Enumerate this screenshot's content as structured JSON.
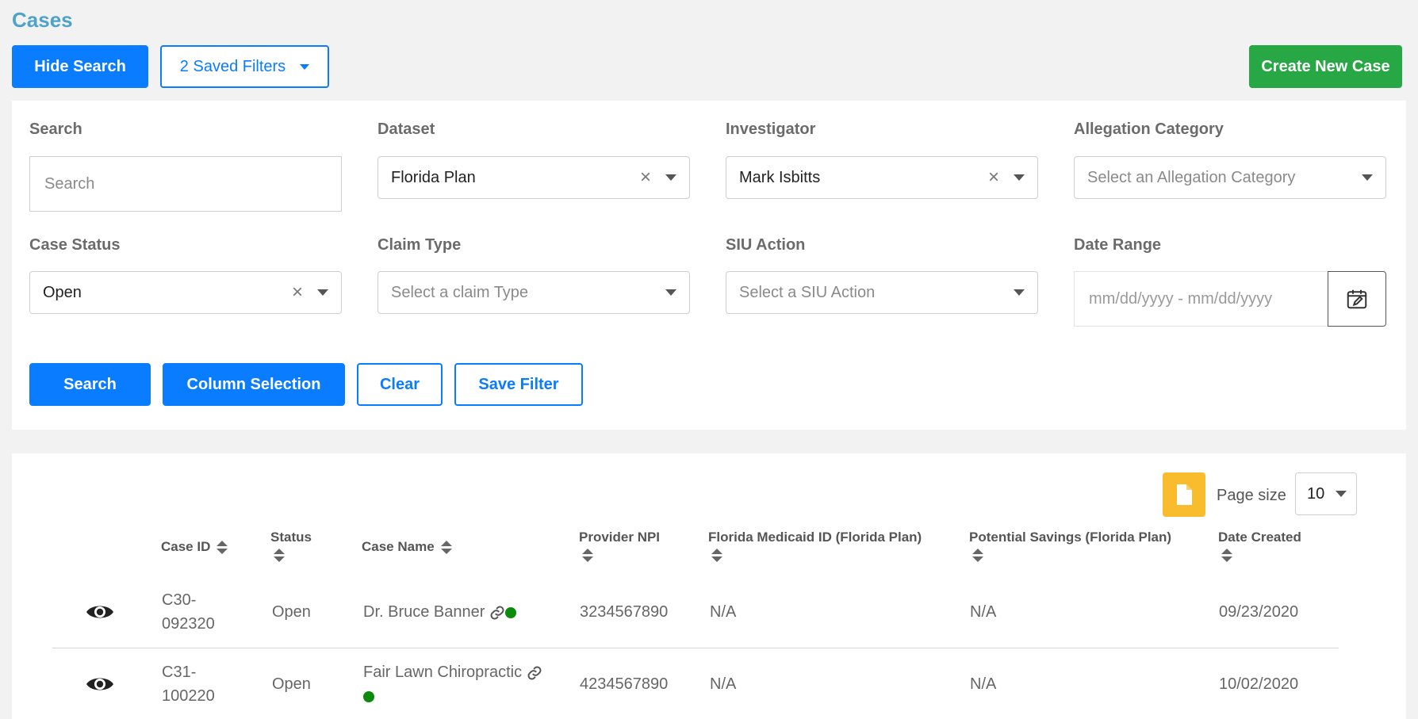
{
  "page": {
    "title": "Cases"
  },
  "toolbar": {
    "hide_search_label": "Hide Search",
    "saved_filters_label": "2 Saved Filters",
    "create_case_label": "Create New Case"
  },
  "filters": {
    "search": {
      "label": "Search",
      "placeholder": "Search",
      "value": ""
    },
    "dataset": {
      "label": "Dataset",
      "value": "Florida Plan"
    },
    "investigator": {
      "label": "Investigator",
      "value": "Mark Isbitts"
    },
    "allegation_category": {
      "label": "Allegation Category",
      "placeholder": "Select an Allegation Category"
    },
    "case_status": {
      "label": "Case Status",
      "value": "Open"
    },
    "claim_type": {
      "label": "Claim Type",
      "placeholder": "Select a claim Type"
    },
    "siu_action": {
      "label": "SIU Action",
      "placeholder": "Select a SIU Action"
    },
    "date_range": {
      "label": "Date Range",
      "placeholder": "mm/dd/yyyy - mm/dd/yyyy"
    },
    "clear_symbol": "×"
  },
  "actions": {
    "search_label": "Search",
    "column_selection_label": "Column Selection",
    "clear_label": "Clear",
    "save_filter_label": "Save Filter"
  },
  "table": {
    "page_size_label": "Page size",
    "page_size_value": "10",
    "columns": {
      "case_id": "Case ID",
      "status": "Status",
      "case_name": "Case Name",
      "provider_npi": "Provider NPI",
      "medicaid_id": "Florida Medicaid ID (Florida Plan)",
      "potential_savings": "Potential Savings (Florida Plan)",
      "date_created": "Date Created"
    },
    "rows": [
      {
        "case_id_1": "C30-",
        "case_id_2": "092320",
        "status": "Open",
        "case_name": "Dr. Bruce Banner",
        "provider_npi": "3234567890",
        "medicaid_id": "N/A",
        "potential_savings": "N/A",
        "date_created": "09/23/2020"
      },
      {
        "case_id_1": "C31-",
        "case_id_2": "100220",
        "status": "Open",
        "case_name": "Fair Lawn Chiropractic",
        "provider_npi": "4234567890",
        "medicaid_id": "N/A",
        "potential_savings": "N/A",
        "date_created": "10/02/2020"
      }
    ]
  },
  "icons": {
    "view": "eye-icon",
    "link": "link-icon",
    "status_dot": "status-dot-icon",
    "export": "document-icon",
    "calendar": "calendar-edit-icon",
    "status_dot_color": "#0c8a0c",
    "export_color": "#f8bc2c"
  }
}
